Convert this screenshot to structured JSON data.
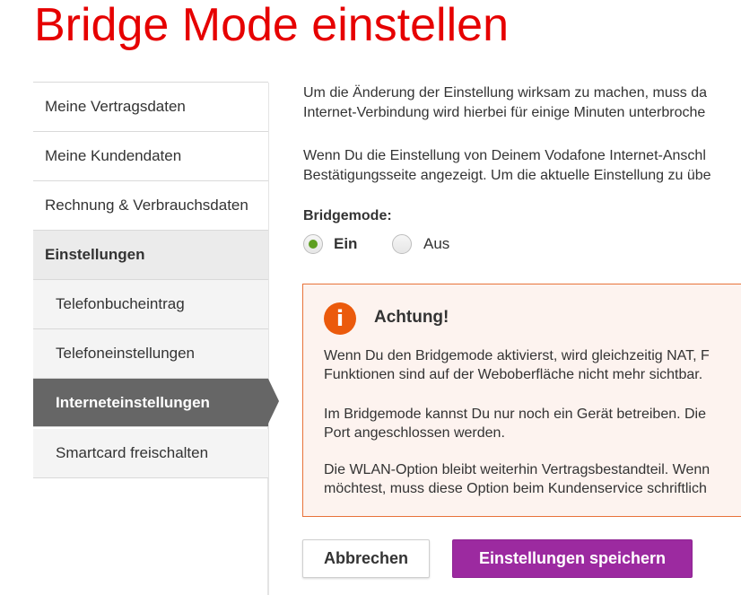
{
  "page": {
    "title": "Bridge Mode einstellen"
  },
  "sidebar": {
    "items": [
      {
        "label": "Meine Vertragsdaten"
      },
      {
        "label": "Meine Kundendaten"
      },
      {
        "label": "Rechnung & Verbrauchsdaten"
      },
      {
        "label": "Einstellungen"
      },
      {
        "label": "Telefonbucheintrag"
      },
      {
        "label": "Telefoneinstellungen"
      },
      {
        "label": "Interneteinstellungen"
      },
      {
        "label": "Smartcard freischalten"
      }
    ]
  },
  "main": {
    "para1": {
      "line1": "Um die Änderung der Einstellung wirksam zu machen, muss da",
      "line2": "Internet-Verbindung wird hierbei für einige Minuten unterbroche"
    },
    "para2": {
      "line1": "Wenn Du die Einstellung von Deinem Vodafone Internet-Anschl",
      "line2": "Bestätigungsseite angezeigt. Um die aktuelle Einstellung zu übe"
    },
    "bridgemode": {
      "label": "Bridgemode:",
      "options": [
        {
          "label": "Ein",
          "selected": true
        },
        {
          "label": "Aus",
          "selected": false
        }
      ]
    },
    "alert": {
      "icon": "info-icon",
      "icon_glyph": "i",
      "title": "Achtung!",
      "p1": {
        "line1": "Wenn Du den Bridgemode aktivierst, wird gleichzeitig NAT, F",
        "line2": "Funktionen sind auf der Weboberfläche nicht mehr sichtbar."
      },
      "p2": {
        "line1": "Im Bridgemode kannst Du nur noch ein Gerät betreiben. Die",
        "line2": "Port angeschlossen werden."
      },
      "p3": {
        "line1": "Die WLAN-Option bleibt weiterhin Vertragsbestandteil. Wenn",
        "line2": "möchtest, muss diese Option beim Kundenservice schriftlich"
      }
    },
    "buttons": {
      "cancel": "Abbrechen",
      "save": "Einstellungen speichern"
    }
  },
  "colors": {
    "brand_red": "#e60000",
    "selected_radio": "#5e9f21",
    "alert_border": "#e8733a",
    "alert_icon": "#eb5a0c",
    "save_button": "#9c2aa0",
    "active_nav": "#666666"
  }
}
